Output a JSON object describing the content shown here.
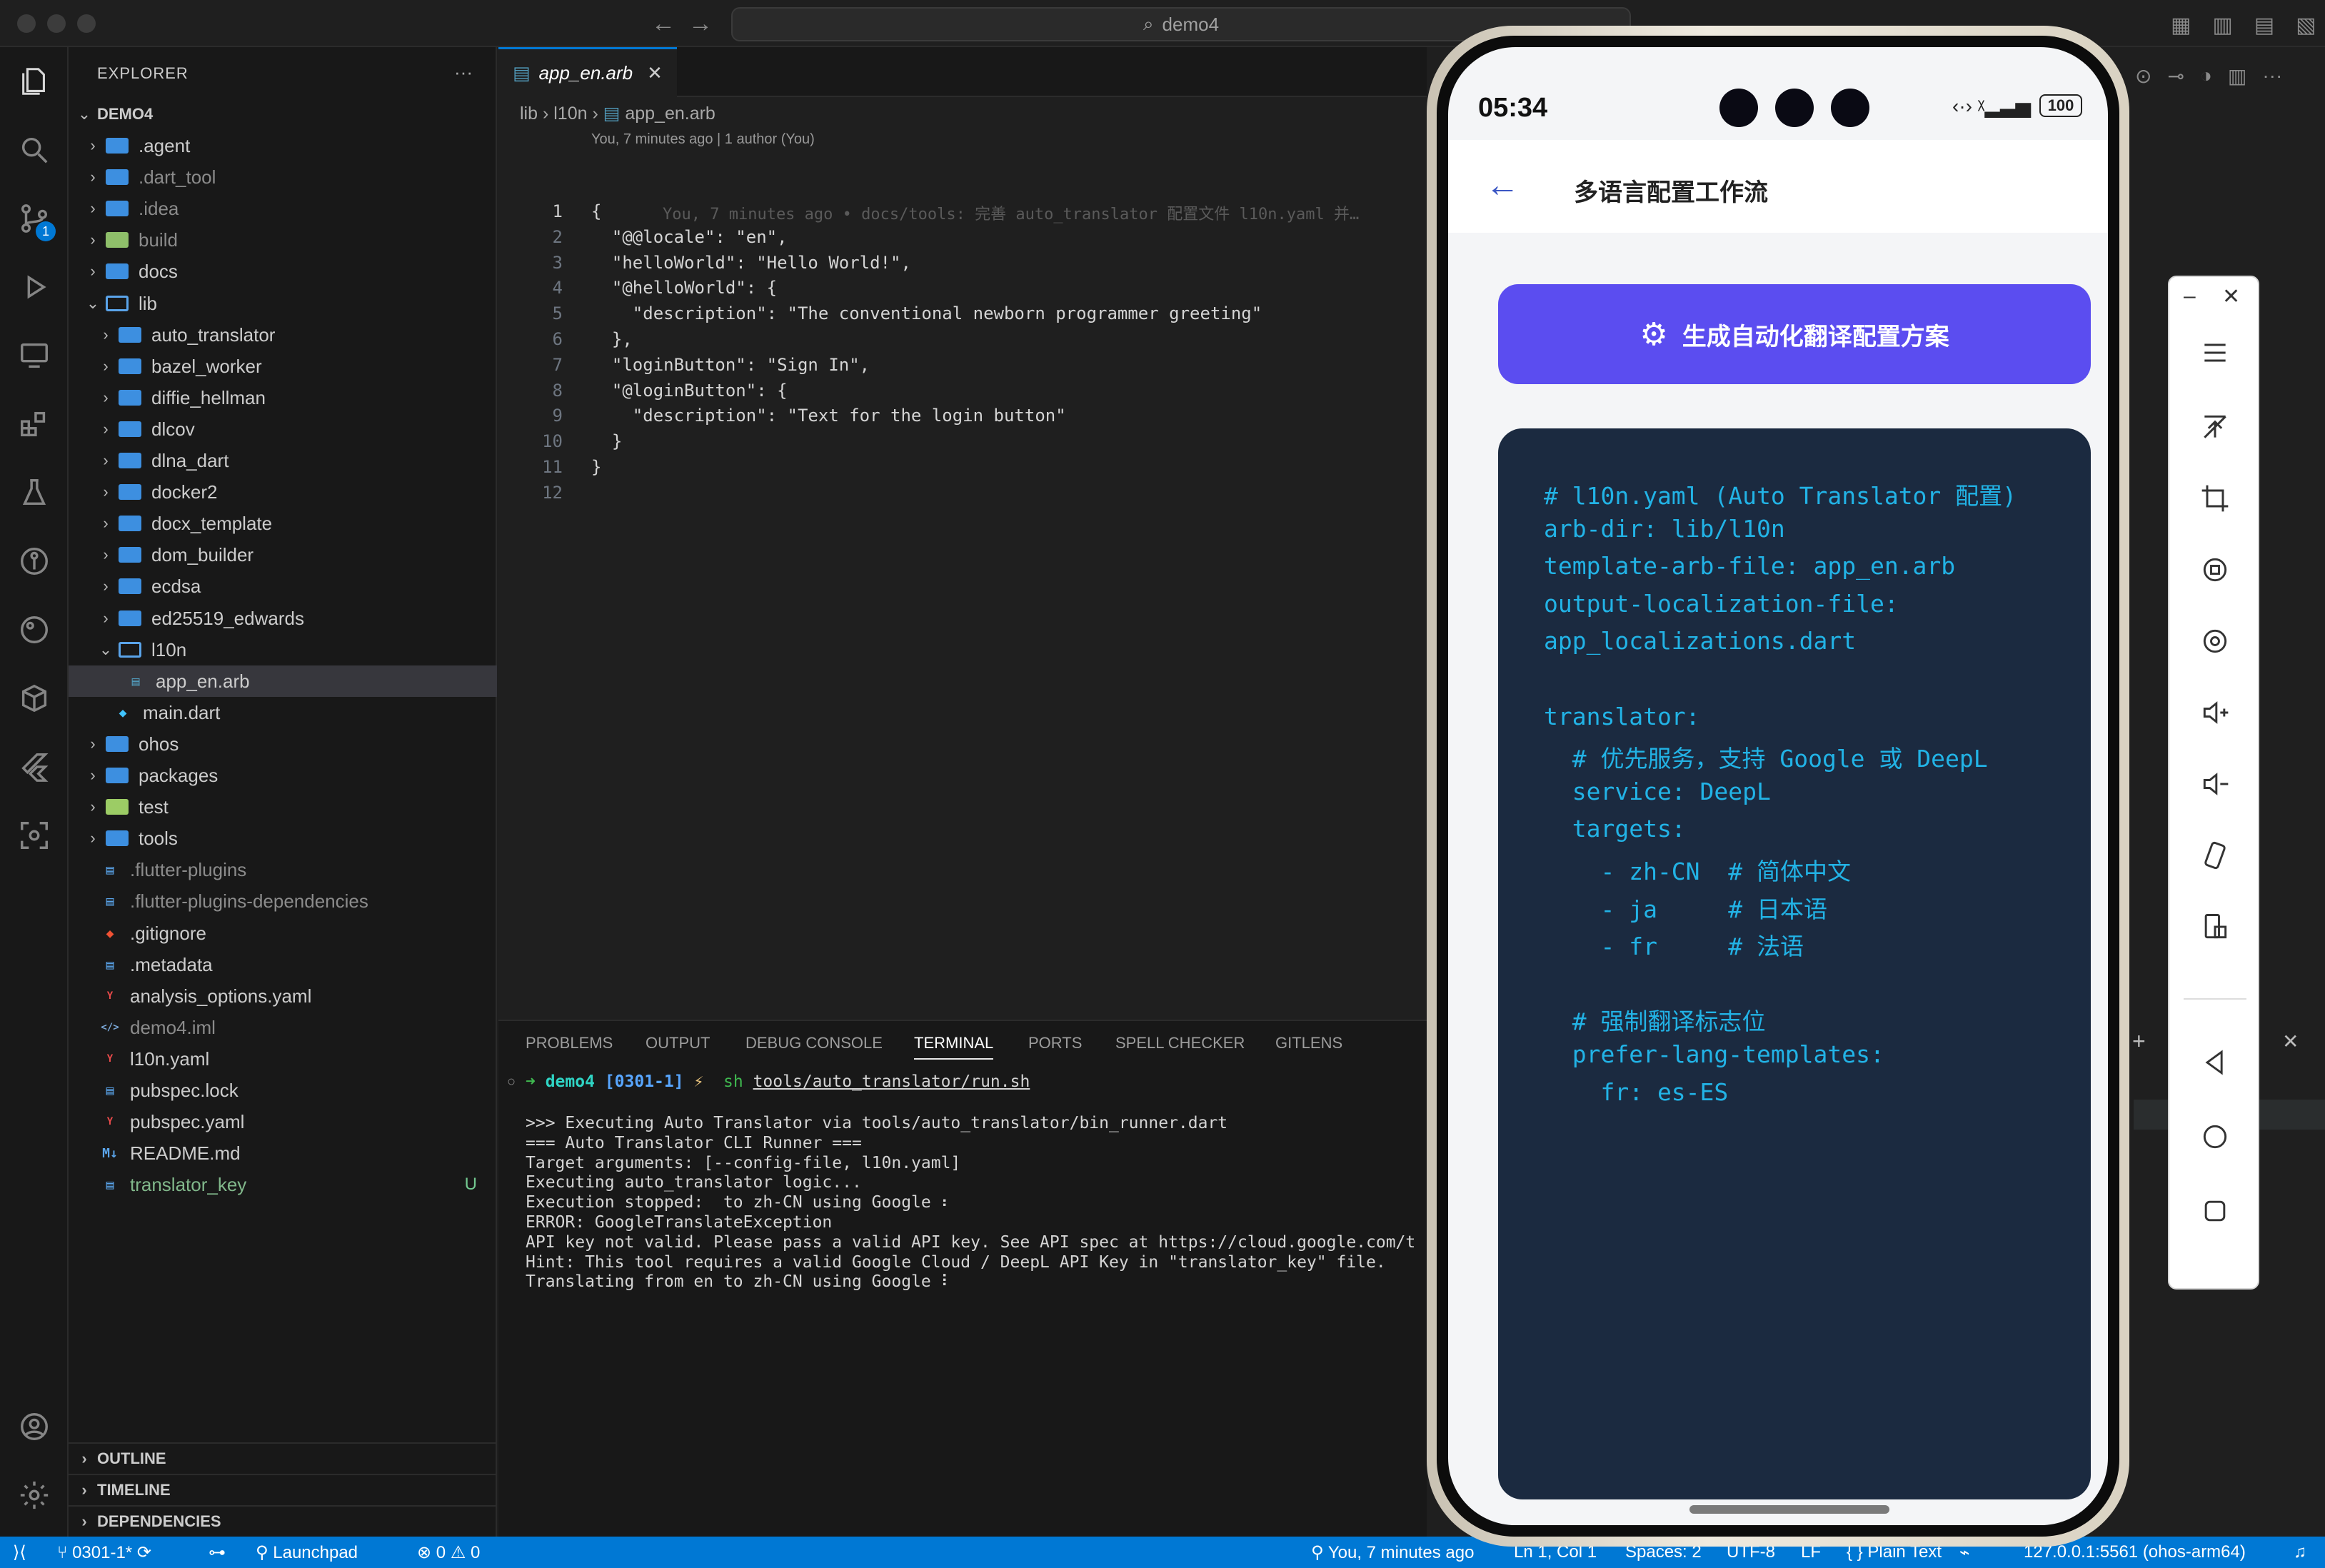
{
  "window": {
    "title": "demo4"
  },
  "explorer": {
    "header": "EXPLORER",
    "root": "DEMO4",
    "items": [
      {
        "label": ".agent",
        "kind": "folder",
        "depth": 0
      },
      {
        "label": ".dart_tool",
        "kind": "folder",
        "depth": 0
      },
      {
        "label": ".idea",
        "kind": "folder",
        "depth": 0
      },
      {
        "label": "build",
        "kind": "folder-build",
        "depth": 0
      },
      {
        "label": "docs",
        "kind": "folder",
        "depth": 0
      },
      {
        "label": "lib",
        "kind": "folder-open",
        "depth": 0
      },
      {
        "label": "auto_translator",
        "kind": "folder",
        "depth": 1
      },
      {
        "label": "bazel_worker",
        "kind": "folder",
        "depth": 1
      },
      {
        "label": "diffie_hellman",
        "kind": "folder",
        "depth": 1
      },
      {
        "label": "dlcov",
        "kind": "folder",
        "depth": 1
      },
      {
        "label": "dlna_dart",
        "kind": "folder",
        "depth": 1
      },
      {
        "label": "docker2",
        "kind": "folder",
        "depth": 1
      },
      {
        "label": "docx_template",
        "kind": "folder",
        "depth": 1
      },
      {
        "label": "dom_builder",
        "kind": "folder",
        "depth": 1
      },
      {
        "label": "ecdsa",
        "kind": "folder",
        "depth": 1
      },
      {
        "label": "ed25519_edwards",
        "kind": "folder",
        "depth": 1
      },
      {
        "label": "l10n",
        "kind": "folder-open",
        "depth": 1
      },
      {
        "label": "app_en.arb",
        "kind": "file-arb",
        "depth": 2
      },
      {
        "label": "main.dart",
        "kind": "file-dart",
        "depth": 1
      },
      {
        "label": "ohos",
        "kind": "folder",
        "depth": 0
      },
      {
        "label": "packages",
        "kind": "folder",
        "depth": 0
      },
      {
        "label": "test",
        "kind": "folder-test",
        "depth": 0
      },
      {
        "label": "tools",
        "kind": "folder",
        "depth": 0
      },
      {
        "label": ".flutter-plugins",
        "kind": "file",
        "depth": 0
      },
      {
        "label": ".flutter-plugins-dependencies",
        "kind": "file",
        "depth": 0
      },
      {
        "label": ".gitignore",
        "kind": "file-git",
        "depth": 0
      },
      {
        "label": ".metadata",
        "kind": "file",
        "depth": 0
      },
      {
        "label": "analysis_options.yaml",
        "kind": "file-yaml",
        "depth": 0
      },
      {
        "label": "demo4.iml",
        "kind": "file-xml",
        "depth": 0
      },
      {
        "label": "l10n.yaml",
        "kind": "file-yaml",
        "depth": 0
      },
      {
        "label": "pubspec.lock",
        "kind": "file",
        "depth": 0
      },
      {
        "label": "pubspec.yaml",
        "kind": "file-yaml",
        "depth": 0
      },
      {
        "label": "README.md",
        "kind": "file-md",
        "depth": 0
      },
      {
        "label": "translator_key",
        "kind": "file",
        "depth": 0,
        "status": "U"
      }
    ],
    "sections": [
      "OUTLINE",
      "TIMELINE",
      "DEPENDENCIES"
    ]
  },
  "editor": {
    "tab": "app_en.arb",
    "breadcrumb": [
      "lib",
      "l10n",
      "app_en.arb"
    ],
    "blame": "You, 7 minutes ago | 1 author (You)",
    "ghost": "You, 7 minutes ago • docs/tools: 完善 auto_translator 配置文件 l10n.yaml 并…",
    "lines": [
      "{",
      "  \"@@locale\": \"en\",",
      "  \"helloWorld\": \"Hello World!\",",
      "  \"@helloWorld\": {",
      "    \"description\": \"The conventional newborn programmer greeting\"",
      "  },",
      "  \"loginButton\": \"Sign In\",",
      "  \"@loginButton\": {",
      "    \"description\": \"Text for the login button\"",
      "  }",
      "}",
      ""
    ]
  },
  "panel": {
    "tabs": [
      "PROBLEMS",
      "OUTPUT",
      "DEBUG CONSOLE",
      "TERMINAL",
      "PORTS",
      "SPELL CHECKER",
      "GITLENS"
    ],
    "active": "TERMINAL",
    "prompt": {
      "dir": "demo4",
      "branch": "[0301-1]",
      "bolt": "⚡",
      "cmd": "sh",
      "arg": "tools/auto_translator/run.sh"
    },
    "output": [
      ">>> Executing Auto Translator via tools/auto_translator/bin_runner.dart",
      "=== Auto Translator CLI Runner ===",
      "Target arguments: [--config-file, l10n.yaml]",
      "Executing auto_translator logic...",
      "Execution stopped:  to zh-CN using Google ⠆",
      "ERROR: GoogleTranslateException",
      "API key not valid. Please pass a valid API key. See API spec at https://cloud.google.com/t",
      "Hint: This tool requires a valid Google Cloud / DeepL API Key in \"translator_key\" file.",
      "Translating from en to zh-CN using Google ⠇"
    ]
  },
  "statusbar": {
    "branch": "0301-1*",
    "launchpad": "Launchpad",
    "errors": "0",
    "warnings": "0",
    "blame": "You, 7 minutes ago",
    "position": "Ln 1, Col 1",
    "spaces": "Spaces: 2",
    "encoding": "UTF-8",
    "eol": "LF",
    "language": "Plain Text",
    "device": "127.0.0.1:5561 (ohos-arm64)"
  },
  "phone": {
    "time": "05:34",
    "battery": "100",
    "title": "多语言配置工作流",
    "button": "生成自动化翻译配置方案",
    "yaml": [
      "# l10n.yaml (Auto Translator 配置)",
      "arb-dir: lib/l10n",
      "template-arb-file: app_en.arb",
      "output-localization-file:",
      "app_localizations.dart",
      "",
      "translator:",
      "  # 优先服务，支持 Google 或 DeepL",
      "  service: DeepL",
      "  targets:",
      "    - zh-CN  # 简体中文",
      "    - ja     # 日本语",
      "    - fr     # 法语",
      "",
      "  # 强制翻译标志位",
      "  prefer-lang-templates:",
      "    fr: es-ES"
    ]
  },
  "colors": {
    "accent": "#0078d4",
    "button": "#5b4df0",
    "codecard": "#1b2a40",
    "yaml": "#22b3e6"
  }
}
